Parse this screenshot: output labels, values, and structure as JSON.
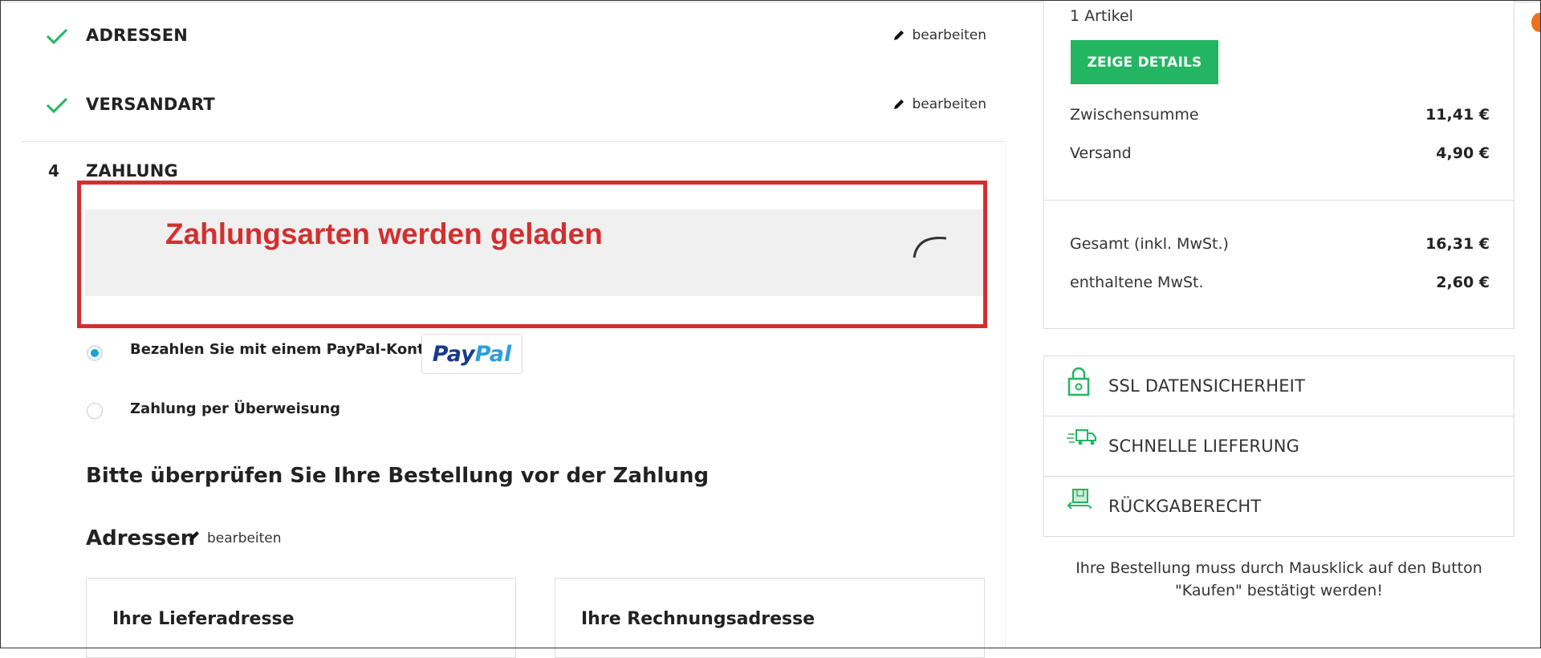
{
  "steps": {
    "adressen": {
      "title": "ADRESSEN",
      "edit": "bearbeiten"
    },
    "versandart": {
      "title": "VERSANDART",
      "edit": "bearbeiten"
    },
    "zahlung": {
      "number": "4",
      "title": "ZAHLUNG"
    }
  },
  "loading": {
    "text": "Zahlungsarten werden geladen"
  },
  "payment_options": [
    {
      "label": "Bezahlen Sie mit einem PayPal-Konto",
      "selected": true
    },
    {
      "label": "Zahlung per Überweisung",
      "selected": false
    }
  ],
  "paypal_logo": {
    "part1": "Pay",
    "part2": "Pal"
  },
  "review": {
    "heading": "Bitte überprüfen Sie Ihre Bestellung vor der Zahlung",
    "addresses_heading": "Adressen",
    "addresses_edit": "bearbeiten",
    "delivery_title": "Ihre Lieferadresse",
    "billing_title": "Ihre Rechnungsadresse"
  },
  "summary": {
    "items": "1 Artikel",
    "details_button": "ZEIGE DETAILS",
    "subtotal_label": "Zwischensumme",
    "subtotal_value": "11,41 €",
    "shipping_label": "Versand",
    "shipping_value": "4,90 €",
    "total_label": "Gesamt (inkl. MwSt.)",
    "total_value": "16,31 €",
    "vat_label": "enthaltene MwSt.",
    "vat_value": "2,60 €"
  },
  "trust_badges": [
    "SSL DATENSICHERHEIT",
    "SCHNELLE LIEFERUNG",
    "RÜCKGABERECHT"
  ],
  "note": "Ihre Bestellung muss durch Mausklick auf den Button \"Kaufen\" bestätigt werden!",
  "colors": {
    "accent_green": "#23b561",
    "alert_red": "#d32f2f",
    "radio_blue": "#1aa3d4",
    "paypal_dark": "#1a3a8a",
    "paypal_light": "#2a9fe0"
  }
}
